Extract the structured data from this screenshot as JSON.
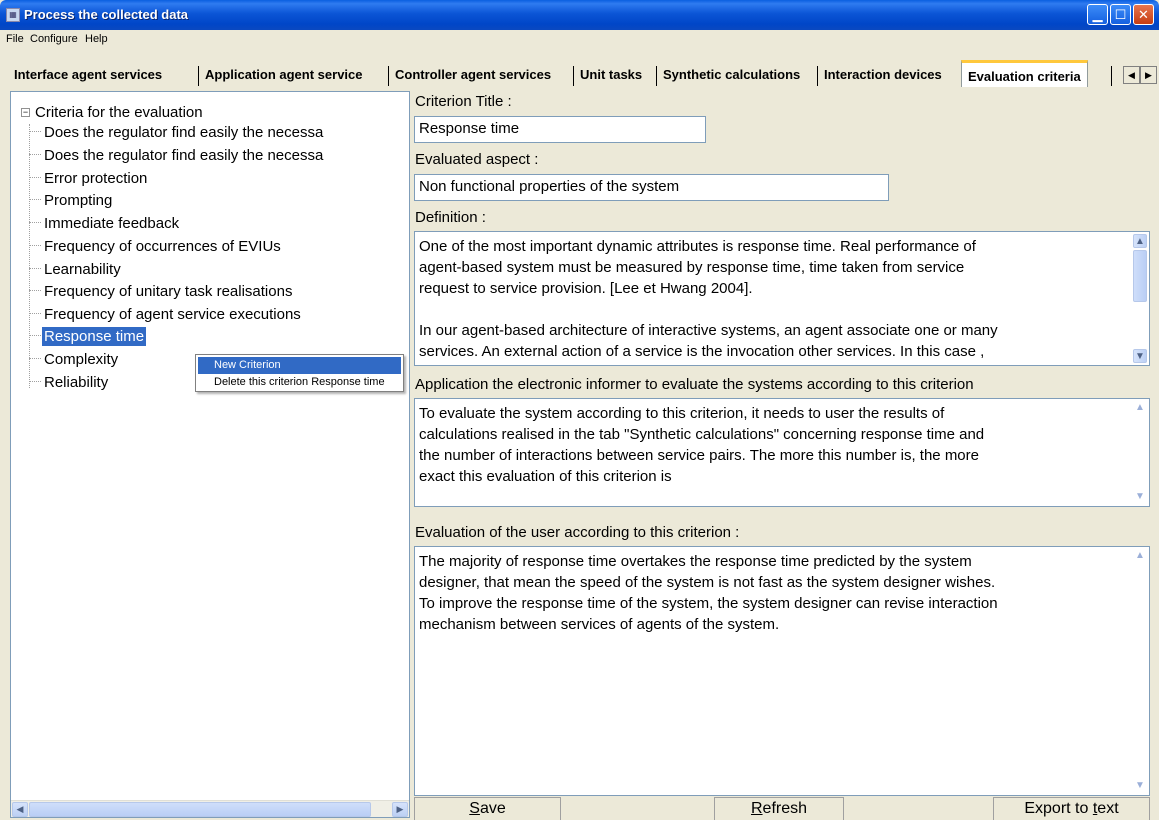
{
  "window": {
    "title": "Process the collected data",
    "icon": "app-icon"
  },
  "menu": [
    "File",
    "Configure",
    "Help"
  ],
  "tabs": [
    "Interface agent services",
    "Application agent service",
    "Controller agent services",
    "Unit tasks",
    "Synthetic calculations",
    "Interaction devices",
    "Evaluation criteria"
  ],
  "active_tab": "Evaluation criteria",
  "tree": {
    "root": "Criteria for the evaluation",
    "items": [
      "Does the regulator find easily the necessa",
      "Does the regulator find easily the necessa",
      "Error protection",
      "Prompting",
      "Immediate feedback",
      "Frequency of occurrences of EVIUs",
      "Learnability",
      "Frequency of unitary task realisations",
      "Frequency of agent service executions",
      "Response time",
      "Complexity",
      "Reliability"
    ],
    "selected": "Response time"
  },
  "context_menu": {
    "items": [
      "New Criterion",
      "Delete this criterion Response time"
    ],
    "highlighted": "New Criterion"
  },
  "form": {
    "criterion_title_label": "Criterion Title :",
    "criterion_title_value": "Response time",
    "evaluated_aspect_label": "Evaluated aspect :",
    "evaluated_aspect_value": "Non functional properties of the system",
    "definition_label": "Definition :",
    "definition_lines": [
      "One of the most important dynamic attributes is response time. Real performance of",
      "agent-based system must be measured by response time, time taken from service",
      "request to service provision. [Lee et Hwang 2004].",
      "",
      "In our agent-based architecture of interactive systems, an agent associate one or many",
      "services. An external action of a service is the invocation other services. In this case ,"
    ],
    "application_label": "Application the electronic informer to evaluate the systems according to this criterion",
    "application_lines": [
      "To evaluate the system according to this criterion, it needs to user the results of",
      "calculations realised in the tab \"Synthetic calculations\" concerning response time and",
      "the number of interactions between service pairs. The more this number is, the more",
      "exact this evaluation of this criterion is"
    ],
    "user_eval_label": "Evaluation of the user according to this criterion :",
    "user_eval_lines": [
      "The majority of response time overtakes the response time predicted by the system",
      "designer, that mean the speed of the system is not fast as the system designer wishes.",
      "To improve the response time of the system, the system designer can revise interaction",
      "mechanism between services of agents of the system."
    ]
  },
  "buttons": {
    "save": {
      "mnemonic": "S",
      "rest": "ave"
    },
    "refresh": {
      "mnemonic": "R",
      "rest": "efresh"
    },
    "export": {
      "prefix": "Export to ",
      "mnemonic": "t",
      "rest": "ext"
    }
  },
  "colors": {
    "selection": "#316ac5",
    "titlebar": "#0054e3",
    "tab_highlight": "#ffc83c"
  }
}
